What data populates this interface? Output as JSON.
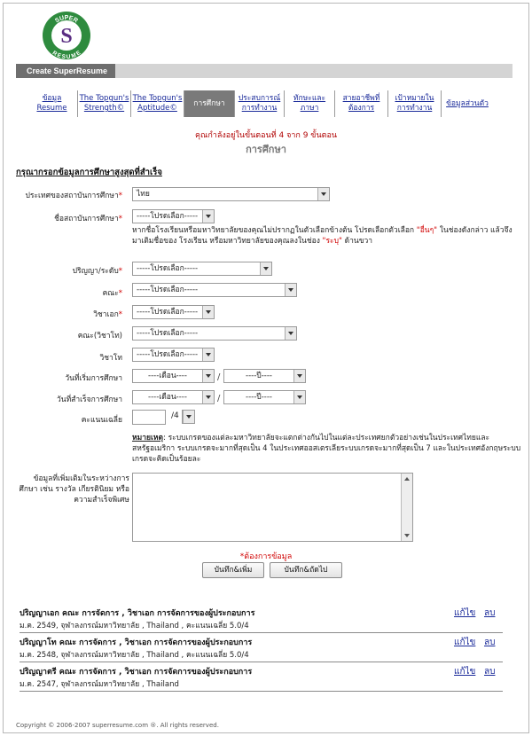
{
  "logo": {
    "word_top": "SUPER",
    "word_bottom": "RESUME",
    "letter": "S",
    "colors": {
      "ring": "#2e8b3e",
      "disc": "#ffffff",
      "letter": "#5a2d82"
    }
  },
  "header": {
    "title": "Create SuperResume"
  },
  "tabs": [
    {
      "label": "ข้อมูล Resume",
      "active": false
    },
    {
      "label": "The Topgun's Strength©",
      "active": false
    },
    {
      "label": "The Topgun's Aptitude©",
      "active": false
    },
    {
      "label": "การศึกษา",
      "active": true
    },
    {
      "label": "ประสบการณ์ การทำงาน",
      "active": false
    },
    {
      "label": "ทักษะและ ภาษา",
      "active": false
    },
    {
      "label": "สายอาชีพที่ ต้องการ",
      "active": false
    },
    {
      "label": "เป้าหมายใน การทำงาน",
      "active": false
    },
    {
      "label": "ข้อมูลส่วนตัว",
      "active": false
    }
  ],
  "step_text": "คุณกำลังอยู่ในขั้นตอนที่ 4 จาก 9 ขั้นตอน",
  "section_title": "การศึกษา",
  "form": {
    "heading": "กรุณากรอกข้อมูลการศึกษาสูงสุดที่สำเร็จ",
    "country": {
      "label": "ประเทศของสถาบันการศึกษา",
      "value": "ไทย"
    },
    "institution": {
      "label": "ชื่อสถาบันการศึกษา",
      "value": "-----โปรดเลือก-----"
    },
    "institution_hint": {
      "p1": "หากชื่อโรงเรียนหรือมหาวิทยาลัยของคุณไม่ปรากฏในตัวเลือกข้างต้น โปรดเลือกตัวเลือก ",
      "q1": "\"อื่นๆ\"",
      "p2": " ในช่องดังกล่าว แล้วจึงมาเติมชื่อของ โรงเรียน หรือมหาวิทยาลัยของคุณลงในช่อง ",
      "q2": "\"ระบุ\"",
      "p3": " ด้านขวา"
    },
    "degree": {
      "label": "ปริญญา/ระดับ",
      "value": "-----โปรดเลือก-----"
    },
    "faculty": {
      "label": "คณะ",
      "value": "-----โปรดเลือก-----"
    },
    "major": {
      "label": "วิชาเอก",
      "value": "-----โปรดเลือก-----"
    },
    "faculty_minor": {
      "label": "คณะ(วิชาโท)",
      "value": "-----โปรดเลือก-----"
    },
    "minor": {
      "label": "วิชาโท",
      "value": "-----โปรดเลือก-----"
    },
    "start": {
      "label": "วันที่เริ่มการศึกษา",
      "month": "----เดือน----",
      "year": "----ปี----"
    },
    "end": {
      "label": "วันที่สำเร็จการศึกษา",
      "month": "----เดือน----",
      "year": "----ปี----"
    },
    "gpa": {
      "label": "คะแนนเฉลี่ย",
      "value": "",
      "scale": "/4"
    },
    "note": {
      "label": "หมายเหตุ",
      "text": ": ระบบเกรดของแต่ละมหาวิทยาลัยจะแตกต่างกันไปในแต่ละประเทศยกตัวอย่างเช่นในประเทศไทยและสหรัฐอเมริกา ระบบเกรดจะมากที่สุดเป็น 4 ในประเทศออสเตรเลียระบบเกรดจะมากที่สุดเป็น 7 และในประเทศอังกฤษระบบเกรดจะคิดเป็นร้อยละ"
    },
    "extra": {
      "label": "ข้อมูลที่เพิ่มเติมในระหว่างการศึกษา เช่น รางวัล เกียรตินิยม หรือความสำเร็จพิเศษ",
      "value": ""
    },
    "required_note": "*ต้องการข้อมูล",
    "save_add": "บันทึก&เพิ่ม",
    "save_next": "บันทึก&ถัดไป"
  },
  "records": [
    {
      "title": "ปริญญาเอก คณะ การจัดการ , วิชาเอก การจัดการของผู้ประกอบการ",
      "detail": "ม.ค. 2549, จุฬาลงกรณ์มหาวิทยาลัย , Thailand , คะแนนเฉลี่ย 5.0/4",
      "edit": "แก้ไข",
      "delete": "ลบ"
    },
    {
      "title": "ปริญญาโท คณะ การจัดการ , วิชาเอก การจัดการของผู้ประกอบการ",
      "detail": "ม.ค. 2548, จุฬาลงกรณ์มหาวิทยาลัย , Thailand , คะแนนเฉลี่ย 5.0/4",
      "edit": "แก้ไข",
      "delete": "ลบ"
    },
    {
      "title": "ปริญญาตรี คณะ การจัดการ , วิชาเอก การจัดการของผู้ประกอบการ",
      "detail": "ม.ค. 2547, จุฬาลงกรณ์มหาวิทยาลัย , Thailand",
      "edit": "แก้ไข",
      "delete": "ลบ"
    }
  ],
  "footer": "Copyright © 2006-2007 superresume.com ®. All rights reserved."
}
